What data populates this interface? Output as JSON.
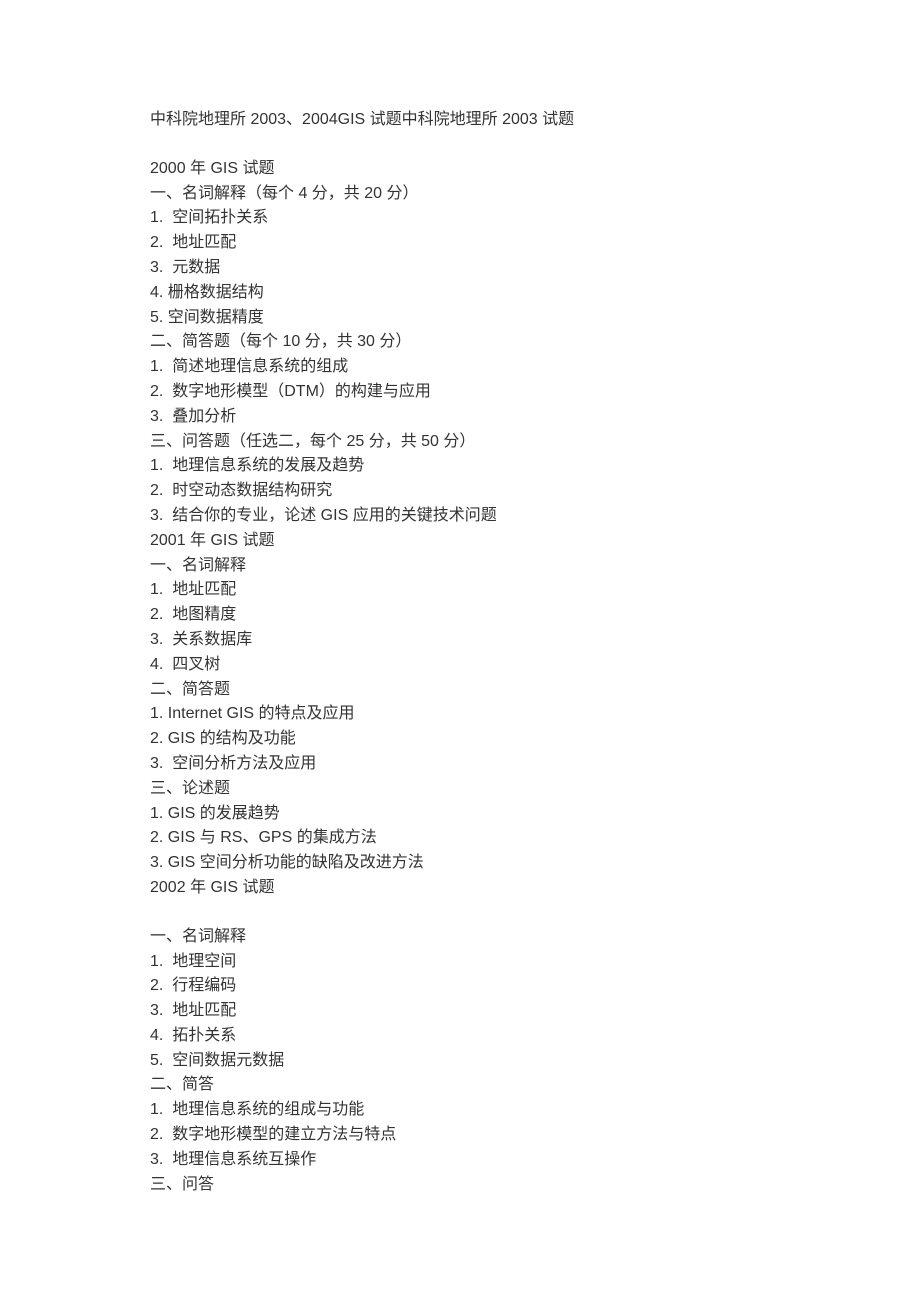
{
  "title": "中科院地理所 2003、2004GIS 试题中科院地理所 2003 试题",
  "sections": [
    {
      "header": "2000 年 GIS 试题",
      "groups": [
        {
          "label": "一、名词解释（每个 4 分，共 20 分）",
          "items": [
            "1.  空间拓扑关系",
            "2.  地址匹配",
            "3.  元数据",
            "4. 栅格数据结构",
            "5. 空间数据精度"
          ]
        },
        {
          "label": "二、简答题（每个 10 分，共 30 分）",
          "items": [
            "1.  简述地理信息系统的组成",
            "2.  数字地形模型（DTM）的构建与应用",
            "3.  叠加分析"
          ]
        },
        {
          "label": "三、问答题（任选二，每个 25 分，共 50 分）",
          "items": [
            "1.  地理信息系统的发展及趋势",
            "2.  时空动态数据结构研究",
            "3.  结合你的专业，论述 GIS 应用的关键技术问题"
          ]
        }
      ]
    },
    {
      "header": "2001 年 GIS 试题",
      "groups": [
        {
          "label": "一、名词解释",
          "items": [
            "1.  地址匹配",
            "2.  地图精度",
            "3.  关系数据库",
            "4.  四叉树"
          ]
        },
        {
          "label": "二、简答题",
          "items": [
            "1. Internet GIS 的特点及应用",
            "2. GIS 的结构及功能",
            "3.  空间分析方法及应用"
          ]
        },
        {
          "label": "三、论述题",
          "items": [
            "1. GIS 的发展趋势",
            "2. GIS 与 RS、GPS 的集成方法",
            "3. GIS 空间分析功能的缺陷及改进方法"
          ]
        }
      ]
    },
    {
      "header": "2002 年 GIS 试题",
      "blank_before_groups": true,
      "groups": [
        {
          "label": "一、名词解释",
          "items": [
            "1.  地理空间",
            "2.  行程编码",
            "3.  地址匹配",
            "4.  拓扑关系",
            "5.  空间数据元数据"
          ]
        },
        {
          "label": "二、简答",
          "items": [
            "1.  地理信息系统的组成与功能",
            "2.  数字地形模型的建立方法与特点",
            "3.  地理信息系统互操作"
          ]
        },
        {
          "label": "三、问答",
          "items": []
        }
      ]
    }
  ]
}
